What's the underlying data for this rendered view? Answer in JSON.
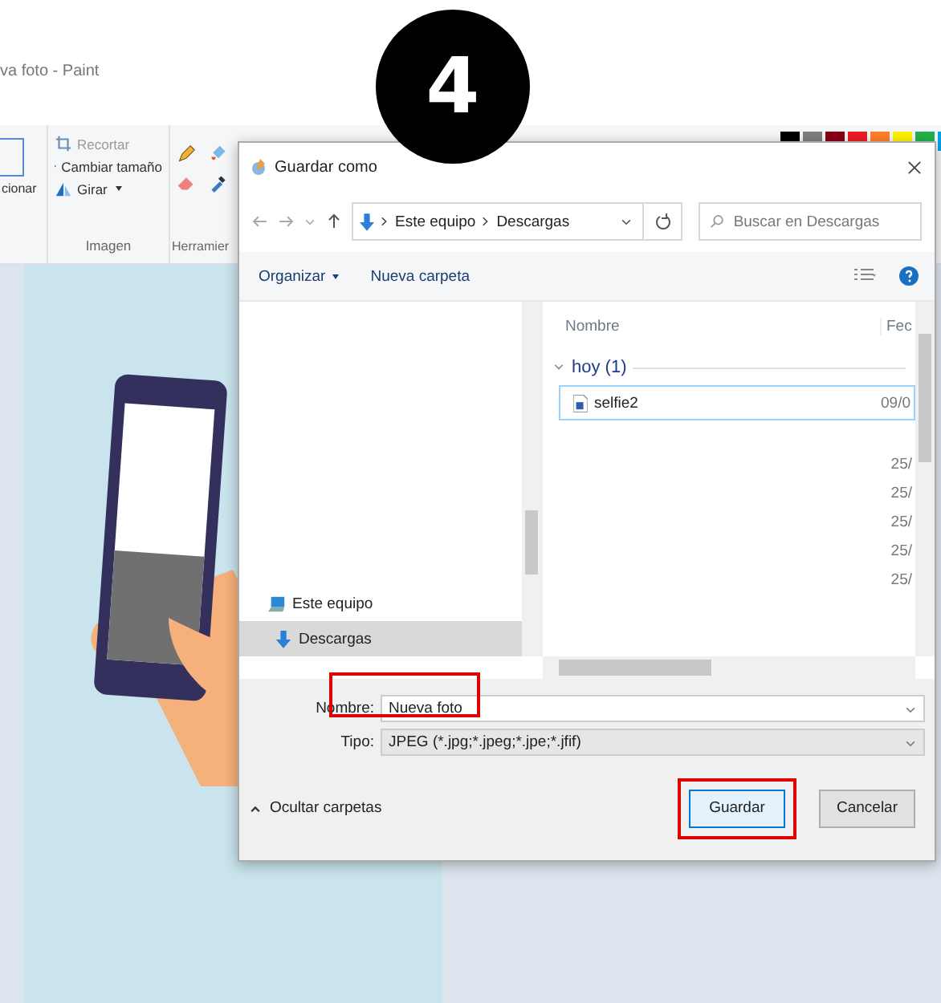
{
  "paint": {
    "title": "va foto - Paint",
    "step_badge": "4",
    "ribbon": {
      "select_label": "cionar",
      "image_tools": [
        {
          "label": "Recortar",
          "disabled": true,
          "has_caret": false
        },
        {
          "label": "Cambiar tamaño",
          "disabled": false,
          "has_caret": false
        },
        {
          "label": "Girar",
          "disabled": false,
          "has_caret": true
        }
      ],
      "image_group": "Imagen",
      "tools_group": "Herramier",
      "palette": [
        {
          "color": "#000000"
        },
        {
          "color": "#7f7f7f"
        },
        {
          "color": "#880015"
        },
        {
          "color": "#ed1c24"
        },
        {
          "color": "#ff7f27"
        },
        {
          "color": "#fff200"
        },
        {
          "color": "#22b14c"
        },
        {
          "color": "#00a2e8"
        }
      ]
    }
  },
  "dialog": {
    "title": "Guardar como",
    "address": {
      "path": [
        "Este equipo",
        "Descargas"
      ]
    },
    "search": {
      "placeholder": "Buscar en Descargas"
    },
    "toolbar": {
      "organize": "Organizar",
      "new_folder": "Nueva carpeta"
    },
    "nav_items": [
      {
        "label": "Este equipo",
        "kind": "computer",
        "selected": false
      },
      {
        "label": "Descargas",
        "kind": "download",
        "selected": true
      }
    ],
    "columns": [
      "Nombre",
      "Fec"
    ],
    "groups": [
      {
        "label": "hoy (1)",
        "expanded": true,
        "files": [
          {
            "name": "selfie2",
            "date": "09/0",
            "selected": true
          }
        ]
      }
    ],
    "more_dates": [
      "25/",
      "25/",
      "25/",
      "25/",
      "25/"
    ],
    "name_label": "Nombre:",
    "name_value": "Nueva foto",
    "type_label": "Tipo:",
    "type_value": "JPEG (*.jpg;*.jpeg;*.jpe;*.jfif)",
    "hide_folders": "Ocultar carpetas",
    "buttons": [
      {
        "label": "Guardar",
        "highlighted": true,
        "default": true
      },
      {
        "label": "Cancelar",
        "highlighted": false,
        "default": false
      }
    ],
    "name_highlighted": true
  }
}
